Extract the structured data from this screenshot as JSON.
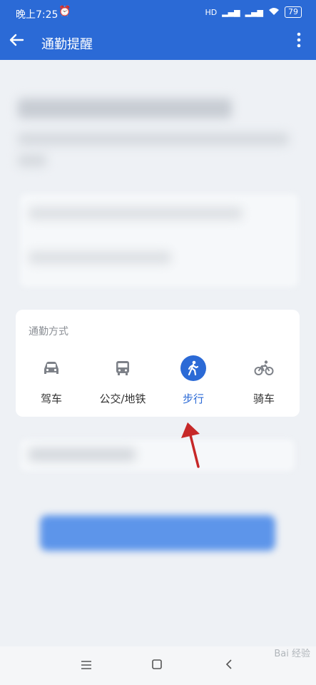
{
  "status_bar": {
    "time": "晚上7:25",
    "battery": "79",
    "network": "HD"
  },
  "app_bar": {
    "title": "通勤提醒"
  },
  "commute_mode": {
    "label": "通勤方式",
    "options": [
      {
        "label": "驾车",
        "icon": "car-icon",
        "selected": false
      },
      {
        "label": "公交/地铁",
        "icon": "bus-icon",
        "selected": false
      },
      {
        "label": "步行",
        "icon": "walk-icon",
        "selected": true
      },
      {
        "label": "骑车",
        "icon": "bike-icon",
        "selected": false
      }
    ]
  },
  "watermark": "Bai 经验",
  "colors": {
    "primary": "#2b6ad6",
    "background": "#eef1f5",
    "arrow": "#c62828"
  }
}
